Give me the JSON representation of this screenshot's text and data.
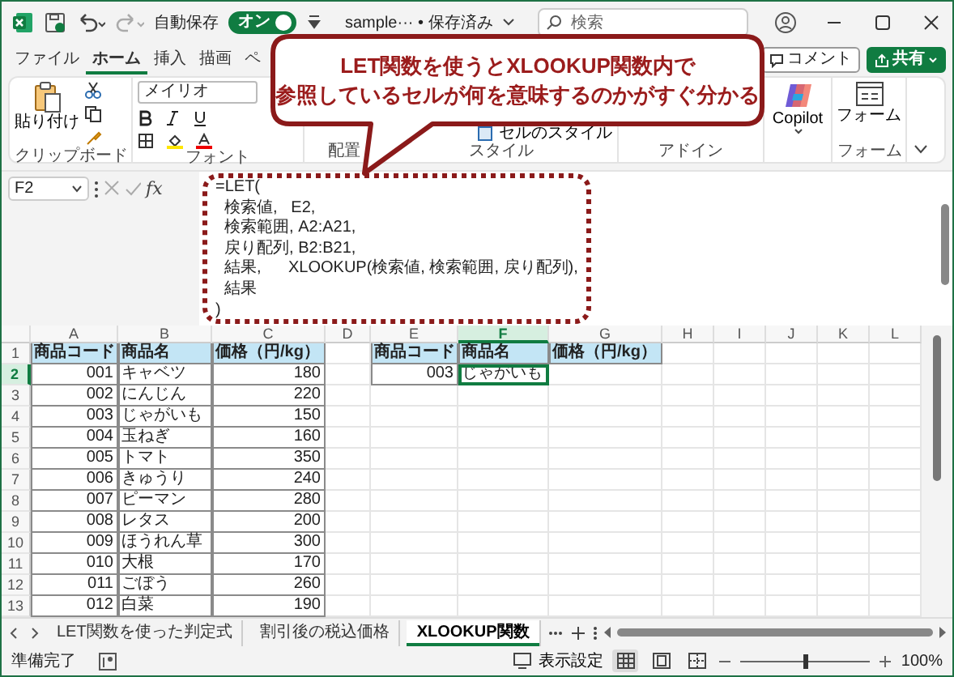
{
  "title_bar": {
    "autosave_label": "自動保存",
    "autosave": {
      "on": true,
      "label": "オン"
    },
    "file_name": "sample··· • 保存済み",
    "search": {
      "placeholder": "検索"
    }
  },
  "ribbon_tabs": [
    {
      "label": "ファイル",
      "selected": false
    },
    {
      "label": "ホーム",
      "selected": true
    },
    {
      "label": "挿入",
      "selected": false
    },
    {
      "label": "描画",
      "selected": false
    },
    {
      "label": "ペ",
      "selected": false
    }
  ],
  "ribbon_actions": [
    {
      "kind": "comment",
      "label": "コメント"
    },
    {
      "kind": "share",
      "label": "共有"
    }
  ],
  "ribbon_groups": [
    {
      "kind": "clipboard",
      "label": "クリップボード",
      "button": "貼り付け"
    },
    {
      "kind": "font",
      "label": "フォント",
      "font_name": "メイリオ"
    },
    {
      "kind": "alignment",
      "label": "配置"
    },
    {
      "kind": "styles",
      "label": "スタイル",
      "button": "セルのスタイル"
    },
    {
      "kind": "addins",
      "label": "アドイン"
    },
    {
      "kind": "copilot",
      "button": "Copilot"
    },
    {
      "kind": "forms",
      "label": "フォーム",
      "button": "フォーム"
    }
  ],
  "callout": {
    "lines": [
      "LET関数を使うとXLOOKUP関数内で",
      "参照しているセルが何を意味するのかがすぐ分かる"
    ]
  },
  "formula_bar": {
    "name_box": "F2",
    "function_label": "fx",
    "lines": [
      "=LET(",
      "  検索値,   E2,",
      "  検索範囲, A2:A21,",
      "  戻り配列, B2:B21,",
      "  結果,      XLOOKUP(検索値, 検索範囲, 戻り配列),",
      "  結果",
      ")"
    ]
  },
  "sheet": {
    "columns": [
      {
        "label": "A",
        "selected": false,
        "kind": "number"
      },
      {
        "label": "B",
        "selected": false,
        "kind": "text"
      },
      {
        "label": "C",
        "selected": false,
        "kind": "number"
      },
      {
        "label": "D",
        "selected": false
      },
      {
        "label": "E",
        "selected": false,
        "kind": "number"
      },
      {
        "label": "F",
        "selected": true,
        "kind": "text"
      },
      {
        "label": "G",
        "selected": false,
        "kind": "number"
      },
      {
        "label": "H",
        "selected": false
      },
      {
        "label": "I",
        "selected": false
      },
      {
        "label": "J",
        "selected": false
      },
      {
        "label": "K",
        "selected": false
      },
      {
        "label": "L",
        "selected": false
      }
    ],
    "rows": [
      {
        "number": "1",
        "selected": false,
        "kind": "header",
        "cells": [
          {
            "text": "商品コード",
            "selected": false
          },
          {
            "text": "商品名",
            "selected": false
          },
          {
            "text": "価格（円/kg）",
            "selected": false
          },
          null,
          {
            "text": "商品コード",
            "selected": false
          },
          {
            "text": "商品名",
            "selected": false
          },
          {
            "text": "価格（円/kg）",
            "selected": false
          },
          null,
          null,
          null,
          null,
          null
        ]
      },
      {
        "number": "2",
        "selected": true,
        "kind": "data",
        "cells": [
          {
            "text": "001",
            "selected": false
          },
          {
            "text": "キャベツ",
            "selected": false
          },
          {
            "text": "180",
            "selected": false
          },
          null,
          {
            "text": "003",
            "selected": false
          },
          {
            "text": "じゃがいも",
            "selected": true
          },
          null,
          null,
          null,
          null,
          null,
          null
        ]
      },
      {
        "number": "3",
        "selected": false,
        "kind": "data",
        "cells": [
          {
            "text": "002",
            "selected": false
          },
          {
            "text": "にんじん",
            "selected": false
          },
          {
            "text": "220",
            "selected": false
          },
          null,
          null,
          null,
          null,
          null,
          null,
          null,
          null,
          null
        ]
      },
      {
        "number": "4",
        "selected": false,
        "kind": "data",
        "cells": [
          {
            "text": "003",
            "selected": false
          },
          {
            "text": "じゃがいも",
            "selected": false
          },
          {
            "text": "150",
            "selected": false
          },
          null,
          null,
          null,
          null,
          null,
          null,
          null,
          null,
          null
        ]
      },
      {
        "number": "5",
        "selected": false,
        "kind": "data",
        "cells": [
          {
            "text": "004",
            "selected": false
          },
          {
            "text": "玉ねぎ",
            "selected": false
          },
          {
            "text": "160",
            "selected": false
          },
          null,
          null,
          null,
          null,
          null,
          null,
          null,
          null,
          null
        ]
      },
      {
        "number": "6",
        "selected": false,
        "kind": "data",
        "cells": [
          {
            "text": "005",
            "selected": false
          },
          {
            "text": "トマト",
            "selected": false
          },
          {
            "text": "350",
            "selected": false
          },
          null,
          null,
          null,
          null,
          null,
          null,
          null,
          null,
          null
        ]
      },
      {
        "number": "7",
        "selected": false,
        "kind": "data",
        "cells": [
          {
            "text": "006",
            "selected": false
          },
          {
            "text": "きゅうり",
            "selected": false
          },
          {
            "text": "240",
            "selected": false
          },
          null,
          null,
          null,
          null,
          null,
          null,
          null,
          null,
          null
        ]
      },
      {
        "number": "8",
        "selected": false,
        "kind": "data",
        "cells": [
          {
            "text": "007",
            "selected": false
          },
          {
            "text": "ピーマン",
            "selected": false
          },
          {
            "text": "280",
            "selected": false
          },
          null,
          null,
          null,
          null,
          null,
          null,
          null,
          null,
          null
        ]
      },
      {
        "number": "9",
        "selected": false,
        "kind": "data",
        "cells": [
          {
            "text": "008",
            "selected": false
          },
          {
            "text": "レタス",
            "selected": false
          },
          {
            "text": "200",
            "selected": false
          },
          null,
          null,
          null,
          null,
          null,
          null,
          null,
          null,
          null
        ]
      },
      {
        "number": "10",
        "selected": false,
        "kind": "data",
        "cells": [
          {
            "text": "009",
            "selected": false
          },
          {
            "text": "ほうれん草",
            "selected": false
          },
          {
            "text": "300",
            "selected": false
          },
          null,
          null,
          null,
          null,
          null,
          null,
          null,
          null,
          null
        ]
      },
      {
        "number": "11",
        "selected": false,
        "kind": "data",
        "cells": [
          {
            "text": "010",
            "selected": false
          },
          {
            "text": "大根",
            "selected": false
          },
          {
            "text": "170",
            "selected": false
          },
          null,
          null,
          null,
          null,
          null,
          null,
          null,
          null,
          null
        ]
      },
      {
        "number": "12",
        "selected": false,
        "kind": "data",
        "cells": [
          {
            "text": "011",
            "selected": false
          },
          {
            "text": "ごぼう",
            "selected": false
          },
          {
            "text": "260",
            "selected": false
          },
          null,
          null,
          null,
          null,
          null,
          null,
          null,
          null,
          null
        ]
      },
      {
        "number": "13",
        "selected": false,
        "kind": "data",
        "cells": [
          {
            "text": "012",
            "selected": false
          },
          {
            "text": "白菜",
            "selected": false
          },
          {
            "text": "190",
            "selected": false
          },
          null,
          null,
          null,
          null,
          null,
          null,
          null,
          null,
          null
        ]
      }
    ]
  },
  "sheet_tabs": [
    {
      "label": "LET関数を使った判定式",
      "selected": false
    },
    {
      "label": "割引後の税込価格",
      "selected": false
    },
    {
      "label": "XLOOKUP関数",
      "selected": true
    }
  ],
  "status_bar": {
    "status": "準備完了",
    "display_settings": "表示設定",
    "view_buttons": [
      {
        "kind": "normal",
        "selected": true
      },
      {
        "kind": "page_layout",
        "selected": false
      },
      {
        "kind": "page_break",
        "selected": false
      }
    ],
    "zoom": {
      "level": 0.5,
      "reading": "100%"
    }
  }
}
